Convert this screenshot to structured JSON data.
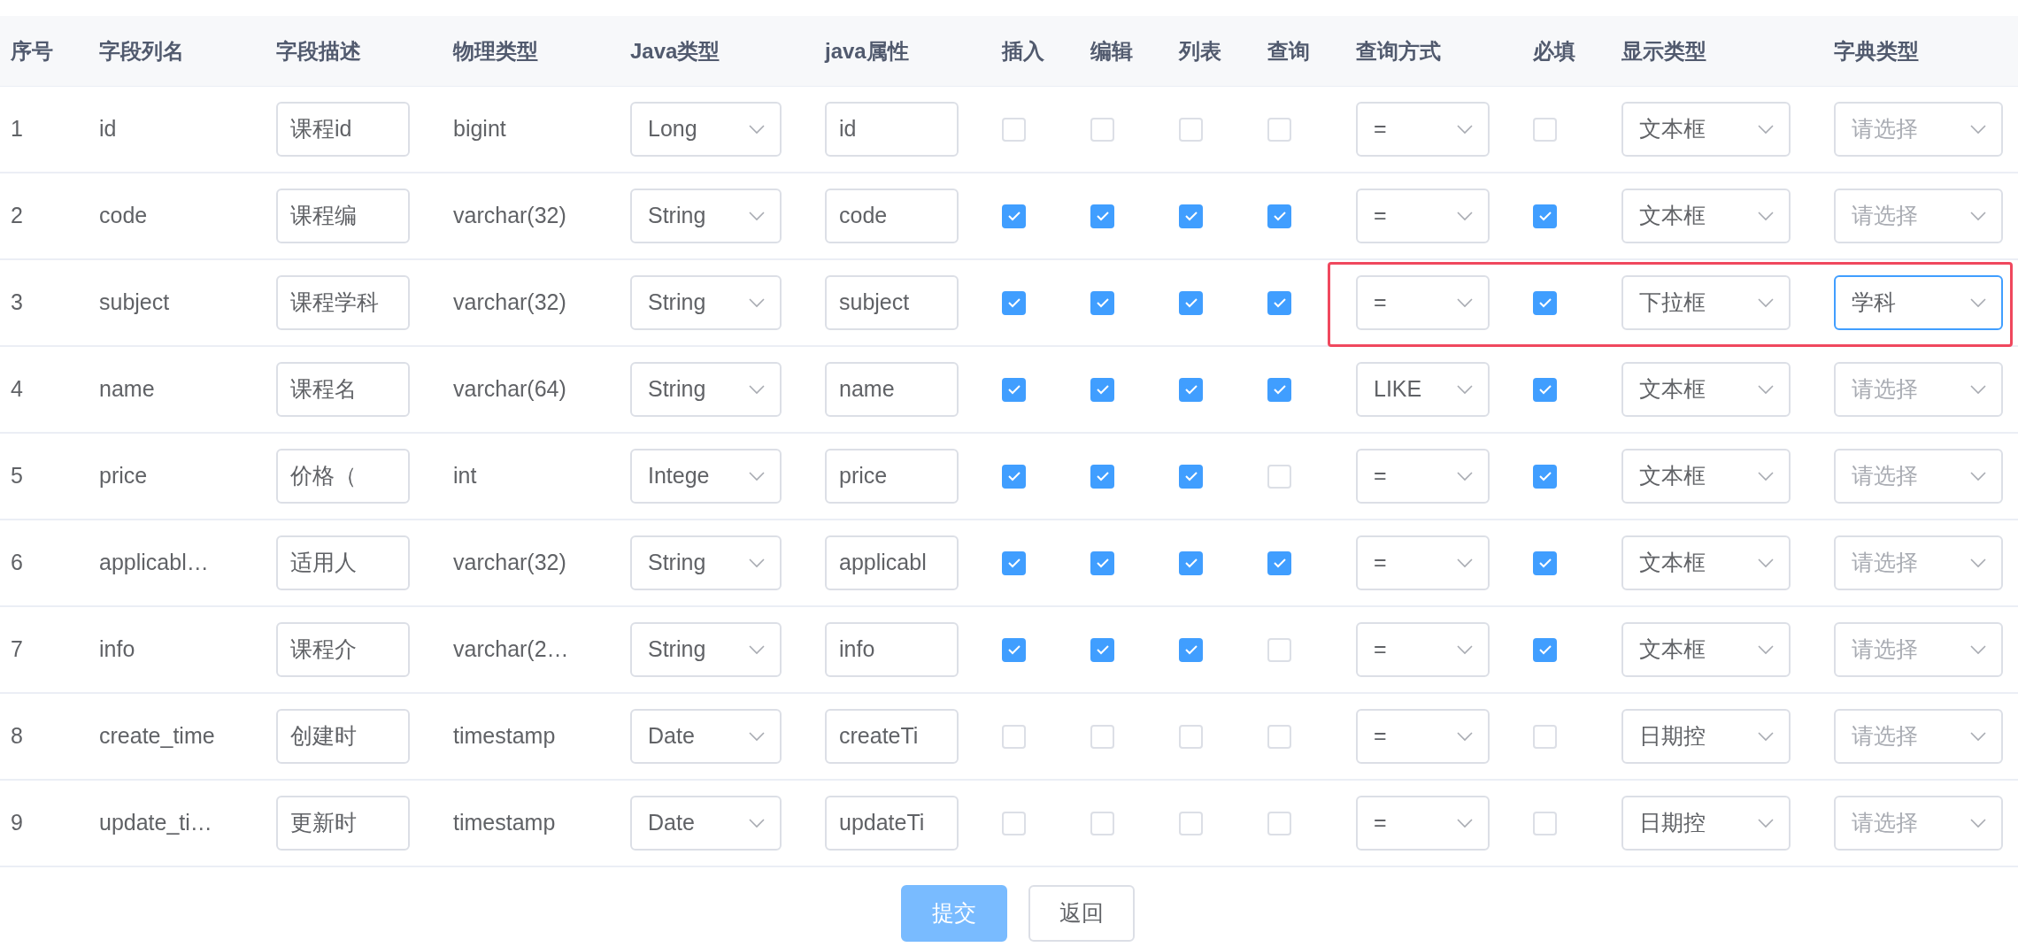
{
  "table": {
    "columns": [
      "序号",
      "字段列名",
      "字段描述",
      "物理类型",
      "Java类型",
      "java属性",
      "插入",
      "编辑",
      "列表",
      "查询",
      "查询方式",
      "必填",
      "显示类型",
      "字典类型"
    ],
    "rows": [
      {
        "index": "1",
        "column_name": "id",
        "description": "课程id",
        "physical_type": "bigint",
        "java_type": "Long",
        "java_field": "id",
        "insert": false,
        "edit": false,
        "list": false,
        "query": false,
        "query_type": "=",
        "required": false,
        "html_type": "文本框",
        "dict_type": {
          "placeholder": "请选择"
        },
        "highlighted": false
      },
      {
        "index": "2",
        "column_name": "code",
        "description": "课程编",
        "physical_type": "varchar(32)",
        "java_type": "String",
        "java_field": "code",
        "insert": true,
        "edit": true,
        "list": true,
        "query": true,
        "query_type": "=",
        "required": true,
        "html_type": "文本框",
        "dict_type": {
          "placeholder": "请选择"
        },
        "highlighted": false
      },
      {
        "index": "3",
        "column_name": "subject",
        "description": "课程学科",
        "physical_type": "varchar(32)",
        "java_type": "String",
        "java_field": "subject",
        "insert": true,
        "edit": true,
        "list": true,
        "query": true,
        "query_type": "=",
        "required": true,
        "html_type": "下拉框",
        "dict_type": {
          "value": "学科",
          "focused": true
        },
        "highlighted": true
      },
      {
        "index": "4",
        "column_name": "name",
        "description": "课程名",
        "physical_type": "varchar(64)",
        "java_type": "String",
        "java_field": "name",
        "insert": true,
        "edit": true,
        "list": true,
        "query": true,
        "query_type": "LIKE",
        "required": true,
        "html_type": "文本框",
        "dict_type": {
          "placeholder": "请选择"
        },
        "highlighted": false
      },
      {
        "index": "5",
        "column_name": "price",
        "description": "价格（",
        "physical_type": "int",
        "java_type": "Intege",
        "java_field": "price",
        "insert": true,
        "edit": true,
        "list": true,
        "query": false,
        "query_type": "=",
        "required": true,
        "html_type": "文本框",
        "dict_type": {
          "placeholder": "请选择"
        },
        "highlighted": false
      },
      {
        "index": "6",
        "column_name": "applicabl…",
        "description": "适用人",
        "physical_type": "varchar(32)",
        "java_type": "String",
        "java_field": "applicabl",
        "insert": true,
        "edit": true,
        "list": true,
        "query": true,
        "query_type": "=",
        "required": true,
        "html_type": "文本框",
        "dict_type": {
          "placeholder": "请选择"
        },
        "highlighted": false
      },
      {
        "index": "7",
        "column_name": "info",
        "description": "课程介",
        "physical_type": "varchar(2…",
        "java_type": "String",
        "java_field": "info",
        "insert": true,
        "edit": true,
        "list": true,
        "query": false,
        "query_type": "=",
        "required": true,
        "html_type": "文本框",
        "dict_type": {
          "placeholder": "请选择"
        },
        "highlighted": false
      },
      {
        "index": "8",
        "column_name": "create_time",
        "description": "创建时",
        "physical_type": "timestamp",
        "java_type": "Date",
        "java_field": "createTi",
        "insert": false,
        "edit": false,
        "list": false,
        "query": false,
        "query_type": "=",
        "required": false,
        "html_type": "日期控",
        "dict_type": {
          "placeholder": "请选择"
        },
        "highlighted": false
      },
      {
        "index": "9",
        "column_name": "update_ti…",
        "description": "更新时",
        "physical_type": "timestamp",
        "java_type": "Date",
        "java_field": "updateTi",
        "insert": false,
        "edit": false,
        "list": false,
        "query": false,
        "query_type": "=",
        "required": false,
        "html_type": "日期控",
        "dict_type": {
          "placeholder": "请选择"
        },
        "highlighted": false
      }
    ]
  },
  "buttons": [
    {
      "label": "提交",
      "kind": "primary"
    },
    {
      "label": "返回",
      "kind": "default"
    }
  ]
}
